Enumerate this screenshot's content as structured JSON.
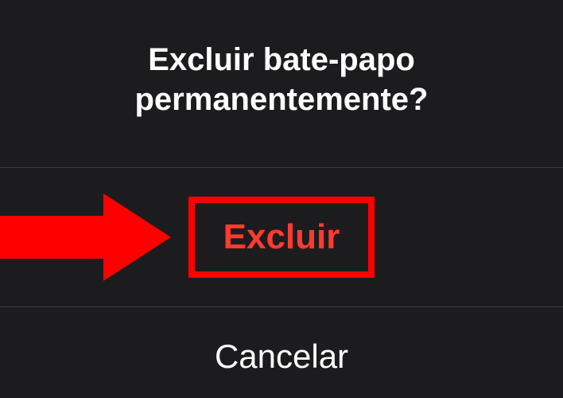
{
  "dialog": {
    "title": "Excluir bate-papo permanentemente?",
    "delete_label": "Excluir",
    "cancel_label": "Cancelar"
  }
}
